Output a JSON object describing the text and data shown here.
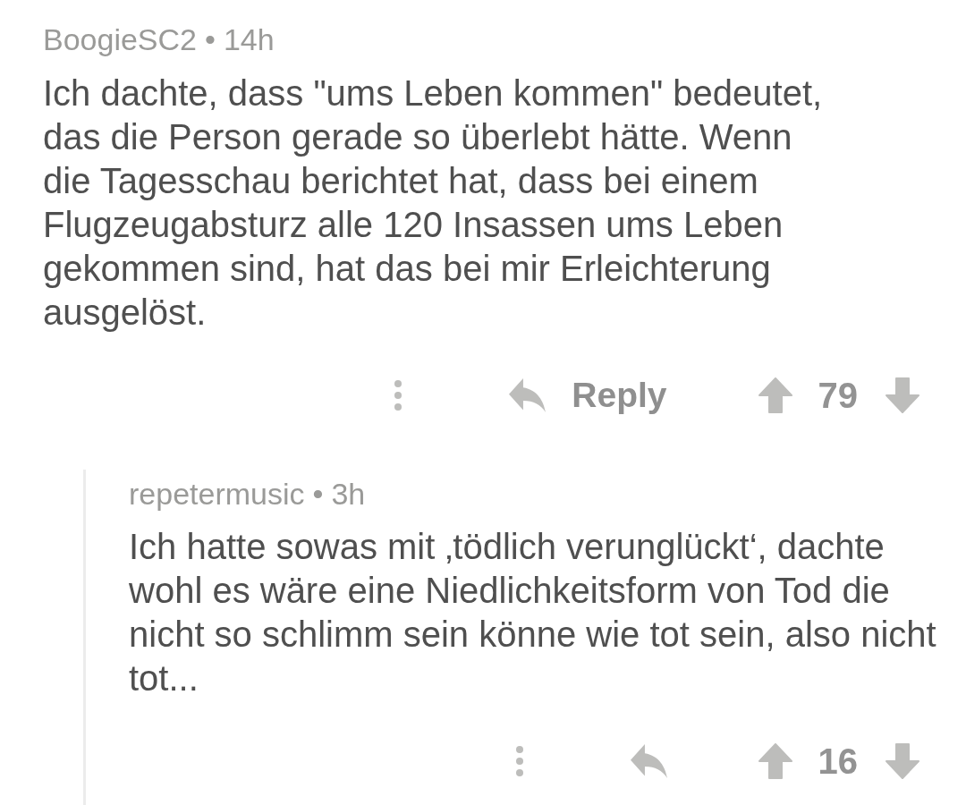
{
  "comments": [
    {
      "author": "BoogieSC2",
      "separator": "•",
      "age": "14h",
      "body": "Ich dachte, dass \"ums Leben kommen\" bedeutet, das die Person gerade so überlebt hätte. Wenn die Tagesschau berichtet hat, dass bei einem Flugzeugabsturz alle 120 Insassen ums Leben gekommen sind, hat das bei mir Erleichterung ausgelöst.",
      "reply_label": "Reply",
      "score": "79",
      "replies": [
        {
          "author": "repetermusic",
          "separator": "•",
          "age": "3h",
          "body": "Ich hatte sowas mit ‚tödlich verunglückt‘, dachte wohl es wäre eine Niedlichkeitsform von Tod die nicht so schlimm sein könne wie tot sein, also nicht tot...",
          "score": "16"
        }
      ]
    }
  ]
}
